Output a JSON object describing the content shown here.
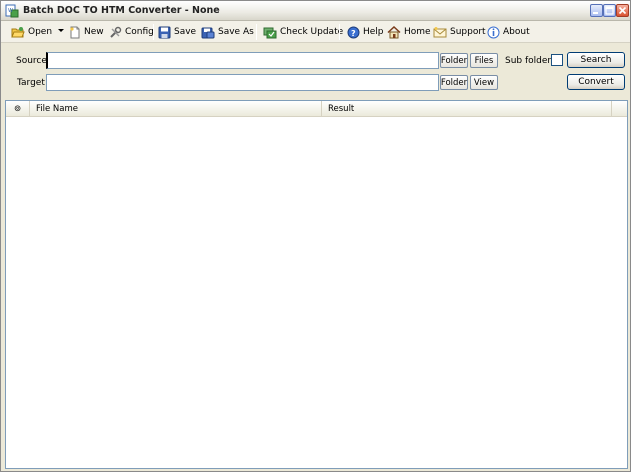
{
  "window": {
    "title": "Batch DOC TO HTM Converter - None"
  },
  "toolbar": {
    "open": "Open",
    "new": "New",
    "config": "Config",
    "save": "Save",
    "save_as": "Save As",
    "check_update": "Check Update",
    "help": "Help",
    "home": "Home",
    "support": "Support",
    "about": "About"
  },
  "form": {
    "source_label": "Source",
    "source_value": "",
    "target_label": "Target",
    "target_value": "",
    "folder_label": "Folder",
    "files_label": "Files",
    "view_label": "View",
    "subfolders_label": "Sub folders",
    "subfolders_checked": false,
    "search_label": "Search",
    "convert_label": "Convert"
  },
  "list": {
    "columns": [
      "⊚",
      "File Name",
      "Result"
    ],
    "rows": []
  },
  "colors": {
    "title_close": "#d9512f",
    "title_btn": "#a8bbf0",
    "input_border": "#7f9db9",
    "window_bg": "#ece9d8"
  }
}
